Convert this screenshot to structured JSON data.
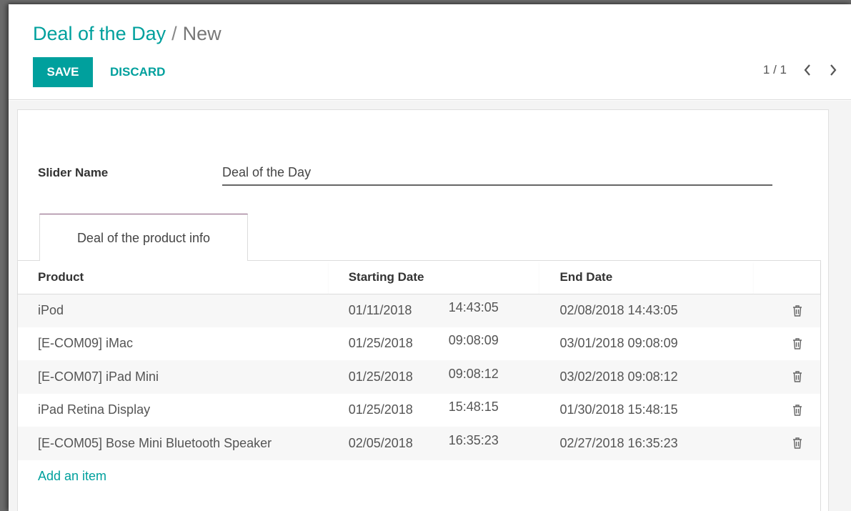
{
  "breadcrumb": {
    "parent": "Deal of the Day",
    "separator": "/",
    "current": "New"
  },
  "toolbar": {
    "save_label": "SAVE",
    "discard_label": "DISCARD"
  },
  "pager": {
    "value": "1 / 1"
  },
  "form": {
    "slider_name_label": "Slider Name",
    "slider_name_value": "Deal of the Day"
  },
  "tabs": [
    {
      "label": "Deal of the product info"
    }
  ],
  "table": {
    "columns": [
      "Product",
      "Starting Date",
      "End Date"
    ],
    "rows": [
      {
        "product": "iPod",
        "start_date": "01/11/2018",
        "start_time": "14:43:05",
        "end": "02/08/2018 14:43:05"
      },
      {
        "product": "[E-COM09] iMac",
        "start_date": "01/25/2018",
        "start_time": "09:08:09",
        "end": "03/01/2018 09:08:09"
      },
      {
        "product": "[E-COM07] iPad Mini",
        "start_date": "01/25/2018",
        "start_time": "09:08:12",
        "end": "03/02/2018 09:08:12"
      },
      {
        "product": "iPad Retina Display",
        "start_date": "01/25/2018",
        "start_time": "15:48:15",
        "end": "01/30/2018 15:48:15"
      },
      {
        "product": "[E-COM05] Bose Mini Bluetooth Speaker",
        "start_date": "02/05/2018",
        "start_time": "16:35:23",
        "end": "02/27/2018 16:35:23"
      }
    ],
    "add_item_label": "Add an item"
  },
  "colors": {
    "accent": "#00a09d",
    "tab_top_border": "#875a7b"
  },
  "icons": {
    "delete": "trash-icon",
    "prev": "chevron-left-icon",
    "next": "chevron-right-icon"
  }
}
